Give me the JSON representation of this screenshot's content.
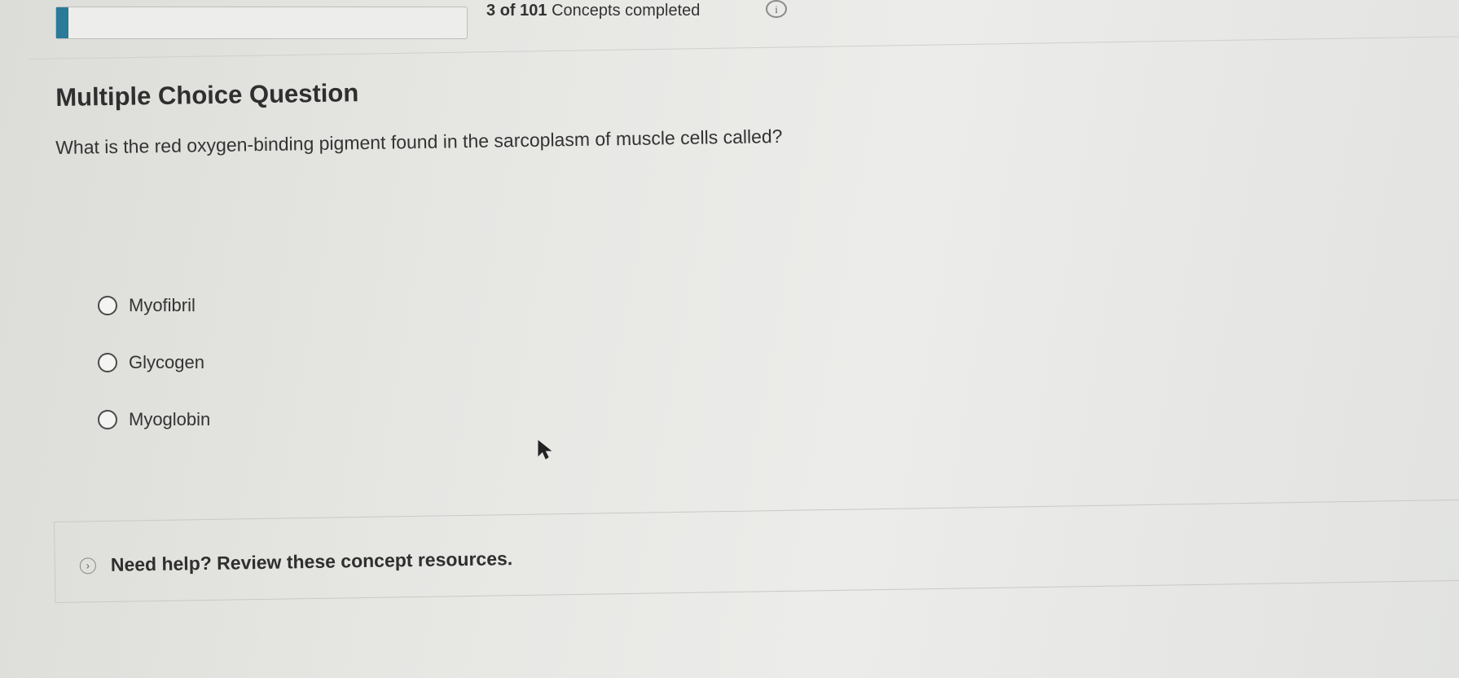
{
  "progress": {
    "current": "3",
    "of_word": "of",
    "total": "101",
    "label": "Concepts completed",
    "fraction": 0.03
  },
  "info_icon": {
    "name": "info-icon",
    "glyph": "i"
  },
  "question": {
    "heading": "Multiple Choice Question",
    "text": "What is the red oxygen-binding pigment found in the sarcoplasm of muscle cells called?"
  },
  "options": [
    {
      "label": "Myofibril"
    },
    {
      "label": "Glycogen"
    },
    {
      "label": "Myoglobin"
    }
  ],
  "help": {
    "icon": "chevron-right-icon",
    "text": "Need help? Review these concept resources."
  },
  "colors": {
    "progress_fill": "#2a7a9a",
    "background": "#e7e7e4"
  }
}
